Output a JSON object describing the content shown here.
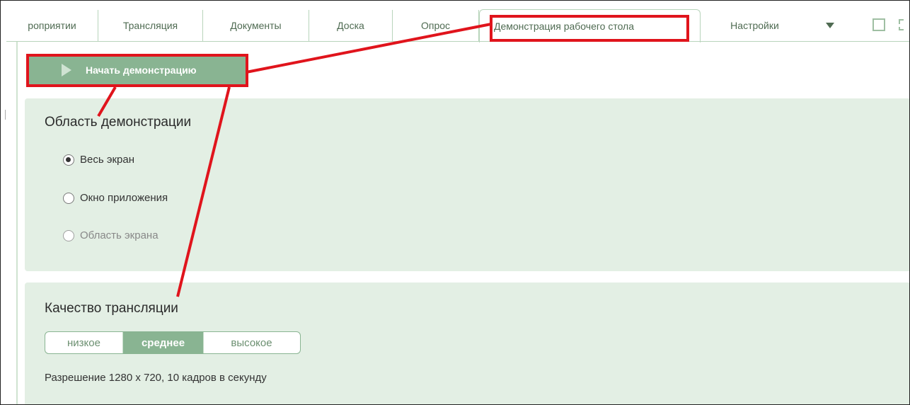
{
  "tabs": [
    {
      "label": "роприятии"
    },
    {
      "label": "Трансляция"
    },
    {
      "label": "Документы"
    },
    {
      "label": "Доска"
    },
    {
      "label": "Опрос"
    },
    {
      "label": "Демонстрация рабочего стола",
      "active": true
    },
    {
      "label": "Настройки"
    }
  ],
  "icons": {
    "dropdown": "dropdown-triangle-icon",
    "window": "square-window-icon",
    "expand": "expand-corners-icon",
    "play": "play-icon"
  },
  "start_button": {
    "label": "Начать демонстрацию"
  },
  "area_section": {
    "title": "Область демонстрации",
    "options": [
      {
        "label": "Весь экран",
        "checked": true,
        "disabled": false
      },
      {
        "label": "Окно приложения",
        "checked": false,
        "disabled": false
      },
      {
        "label": "Область экрана",
        "checked": false,
        "disabled": true
      }
    ]
  },
  "quality_section": {
    "title": "Качество трансляции",
    "options": [
      "низкое",
      "среднее",
      "высокое"
    ],
    "selected": "среднее",
    "resolution_text": "Разрешение 1280 x 720, 10 кадров в секунду"
  },
  "colors": {
    "accent": "#89b492",
    "panel_bg": "#e3efe4",
    "highlight": "#e0141c"
  }
}
